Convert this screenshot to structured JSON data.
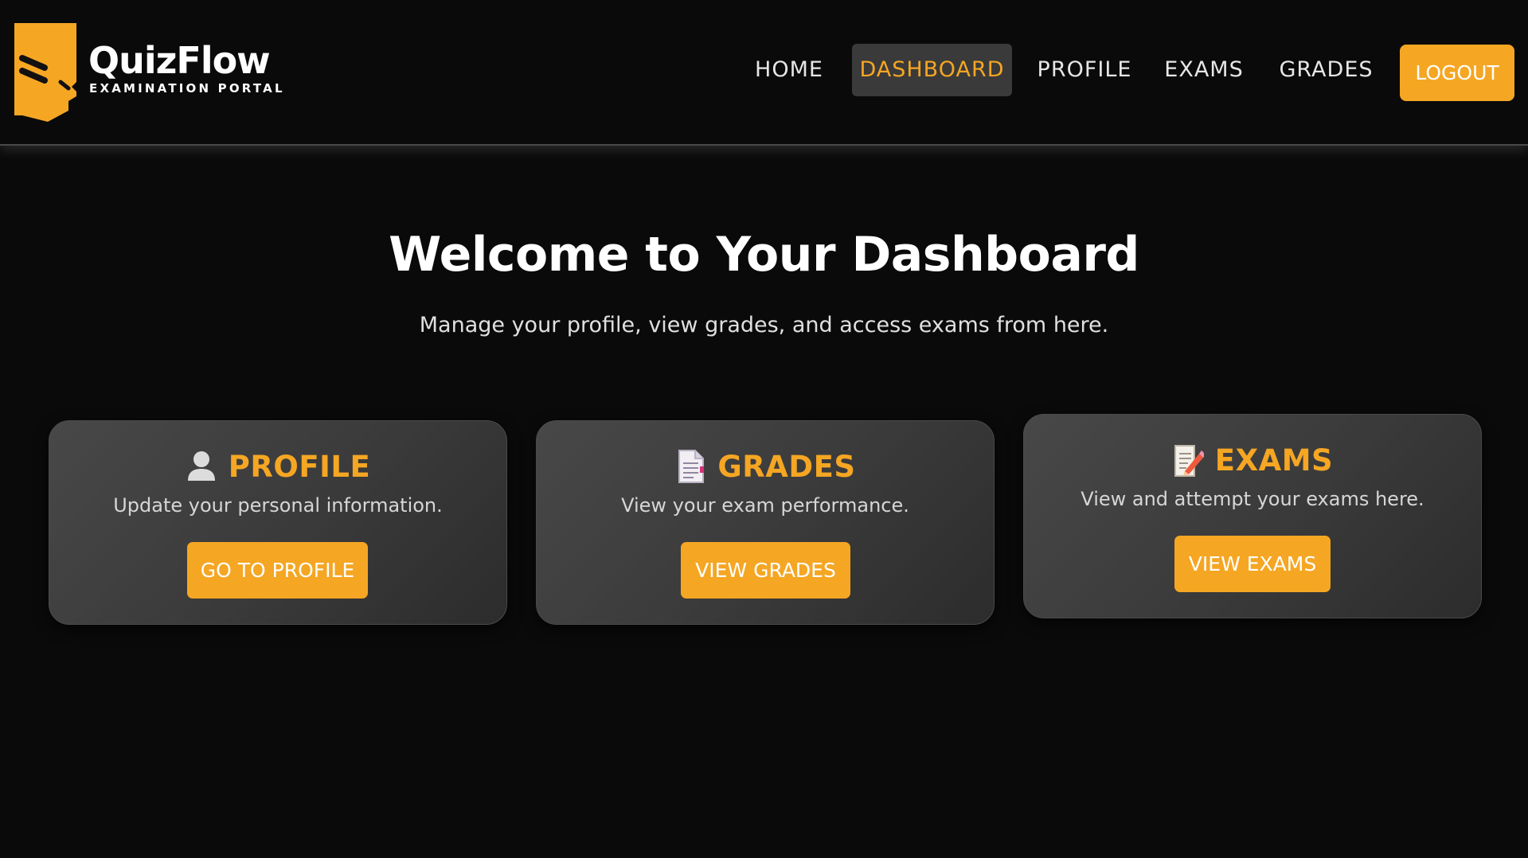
{
  "brand": {
    "name": "QuizFlow",
    "tagline": "EXAMINATION PORTAL",
    "accent_color": "#f5a623"
  },
  "nav": {
    "items": [
      {
        "label": "HOME",
        "active": false
      },
      {
        "label": "DASHBOARD",
        "active": true
      },
      {
        "label": "PROFILE",
        "active": false
      },
      {
        "label": "EXAMS",
        "active": false
      },
      {
        "label": "GRADES",
        "active": false
      }
    ],
    "logout_label": "LOGOUT"
  },
  "hero": {
    "title": "Welcome to Your Dashboard",
    "subtitle": "Manage your profile, view grades, and access exams from here."
  },
  "cards": [
    {
      "icon": "user-icon",
      "title": "PROFILE",
      "description": "Update your personal information.",
      "button": "GO TO PROFILE"
    },
    {
      "icon": "document-icon",
      "title": "GRADES",
      "description": "View your exam performance.",
      "button": "VIEW GRADES"
    },
    {
      "icon": "memo-pencil-icon",
      "title": "EXAMS",
      "description": "View and attempt your exams here.",
      "button": "VIEW EXAMS"
    }
  ]
}
